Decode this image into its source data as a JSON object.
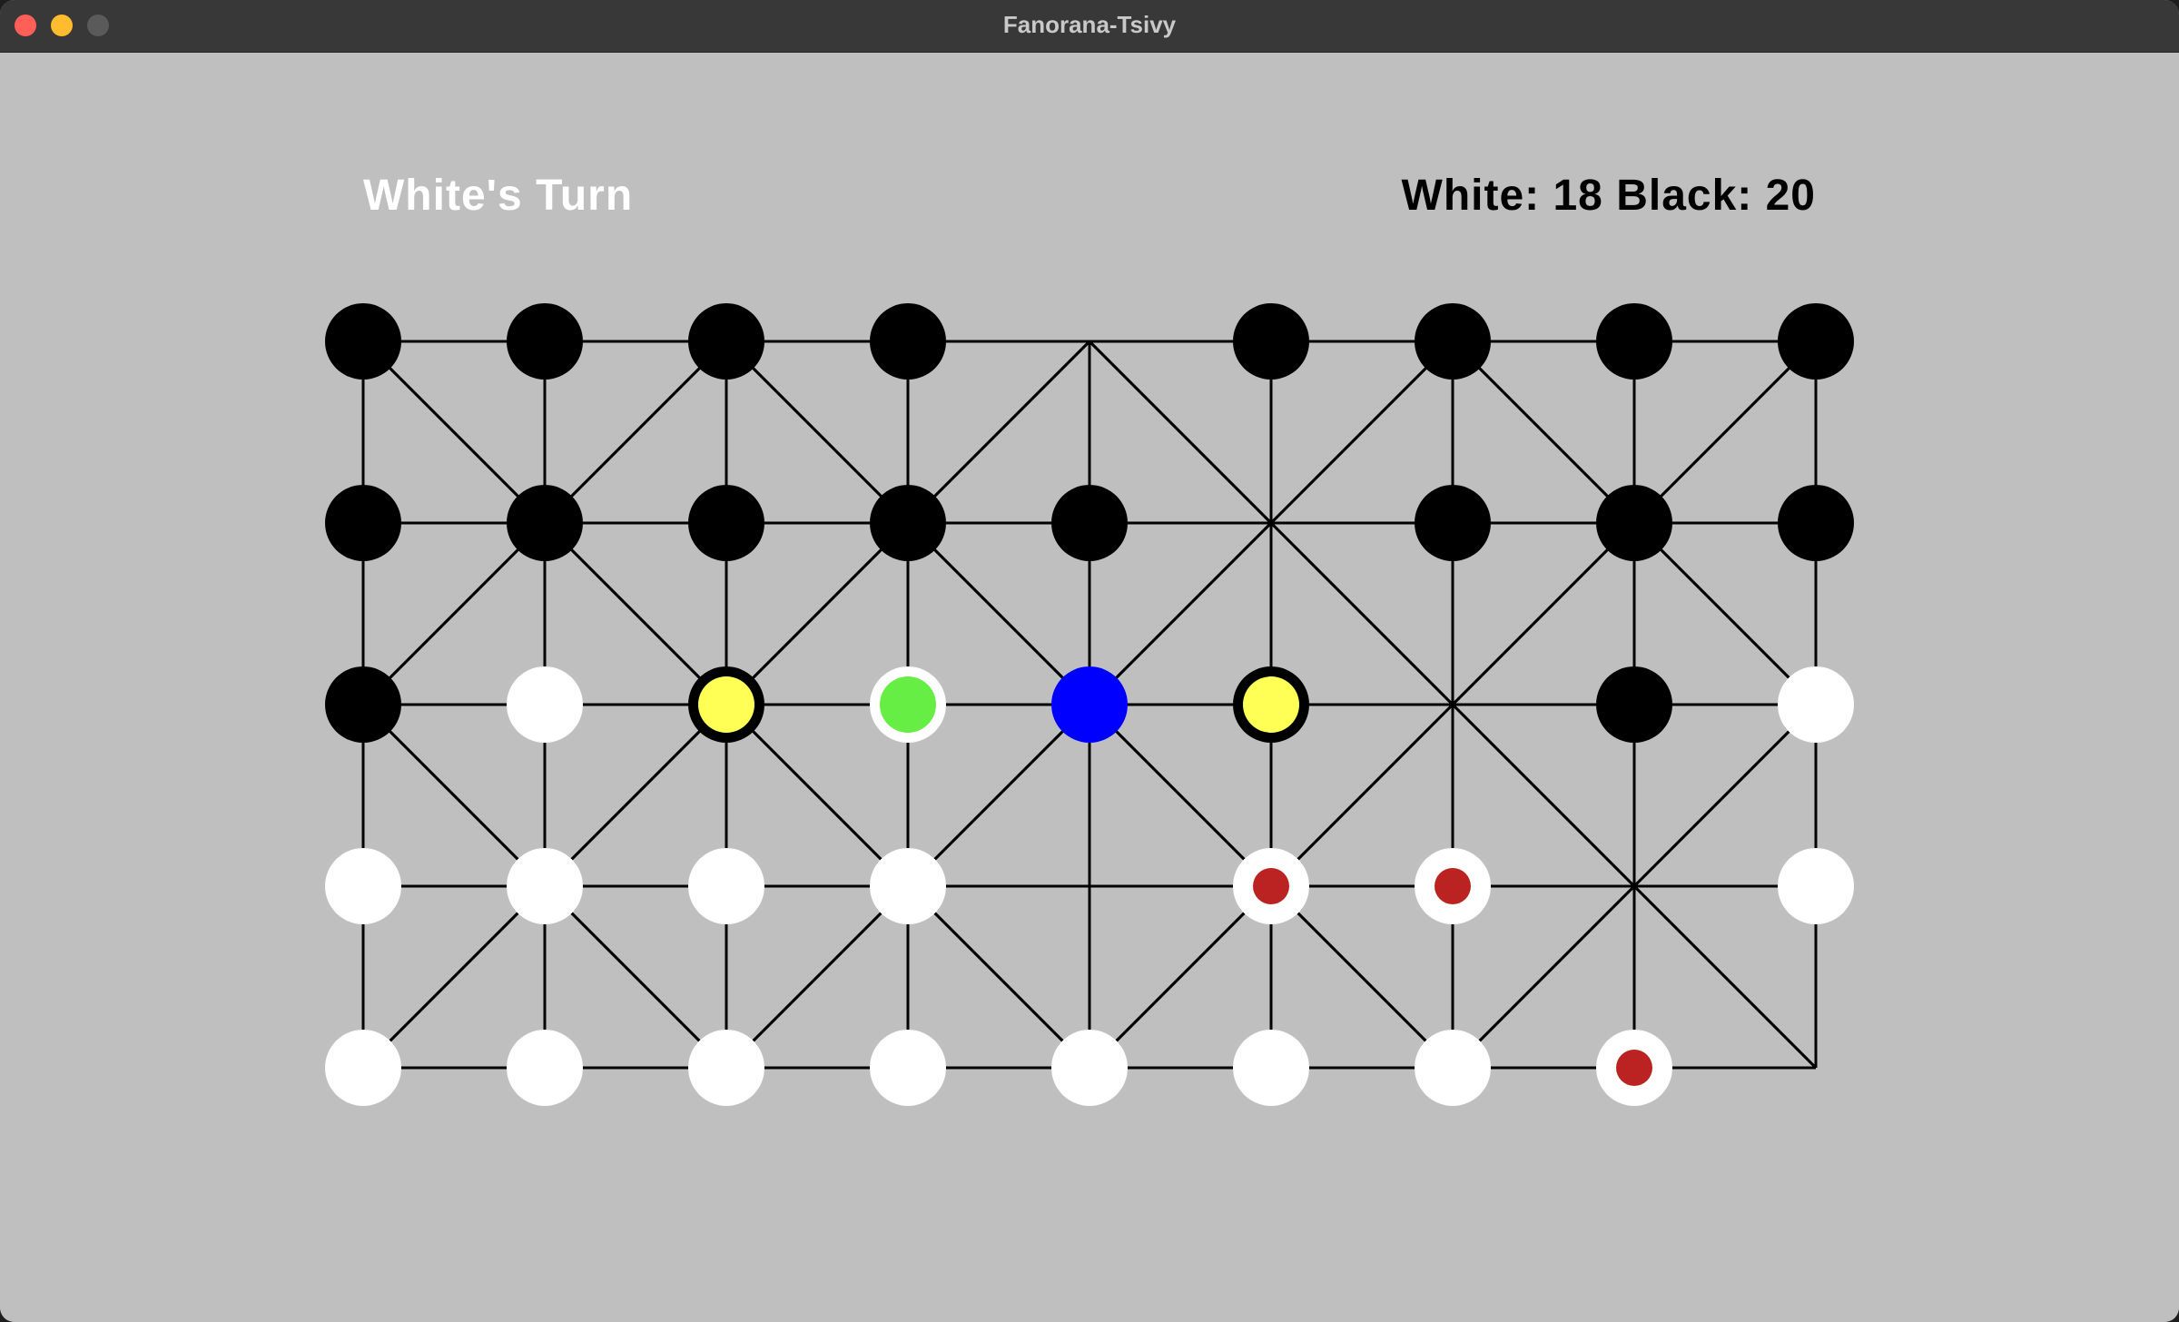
{
  "window": {
    "title": "Fanorana-Tsivy"
  },
  "status": {
    "turn_text": "White's Turn",
    "score_text": "White: 18 Black: 20"
  },
  "colors": {
    "background": "#bfbfbf",
    "black_piece": "#000000",
    "white_piece": "#ffffff",
    "selected_piece": "#0000ff",
    "capture_target": "#ffff55",
    "move_target": "#66ee44",
    "marked_dot": "#bb2222"
  },
  "board": {
    "cols": 9,
    "rows": 5,
    "pieces": [
      [
        "black",
        "black",
        "black",
        "black",
        "empty",
        "black",
        "black",
        "black",
        "black"
      ],
      [
        "black",
        "black",
        "black",
        "black",
        "black",
        "empty",
        "black",
        "black",
        "black"
      ],
      [
        "black",
        "white",
        "yellow-ring",
        "green-ring",
        "blue",
        "yellow-ring",
        "empty",
        "black",
        "white"
      ],
      [
        "white",
        "white",
        "white",
        "white",
        "empty",
        "white-red",
        "white-red",
        "empty",
        "white"
      ],
      [
        "white",
        "white",
        "white",
        "white",
        "white",
        "white",
        "white",
        "white-red",
        "empty"
      ]
    ]
  }
}
